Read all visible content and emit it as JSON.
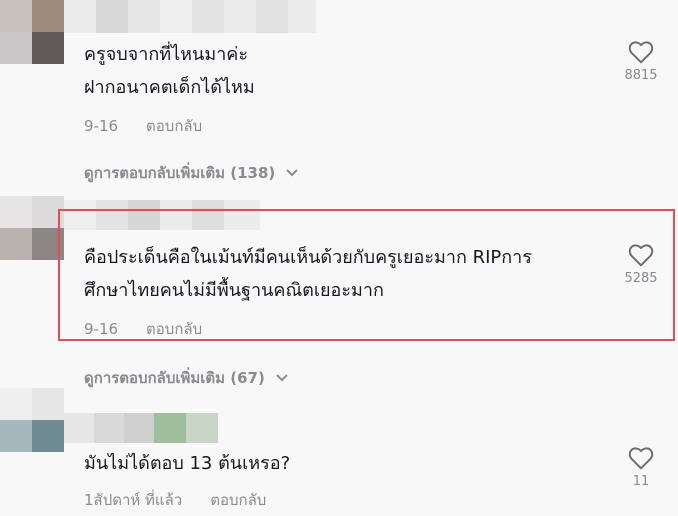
{
  "comments": [
    {
      "text_lines": [
        "ครูจบจากที่ไหนมาค่ะ",
        "ฝากอนาคตเด็กได้ไหม"
      ],
      "date": "9-16",
      "reply_label": "ตอบกลับ",
      "likes": "8815",
      "icons": {
        "like": "heart-outline-icon"
      }
    },
    {
      "text_lines": [
        "คือประเด็นคือในเม้นท์มีคนเห็นด้วยกับครูเยอะมาก RIPการ",
        "ศึกษาไทยคนไม่มีพื้นฐานคณิตเยอะมาก"
      ],
      "date": "9-16",
      "reply_label": "ตอบกลับ",
      "likes": "5285",
      "highlight_color": "#e84a55",
      "icons": {
        "like": "heart-outline-icon"
      }
    },
    {
      "text_lines": [
        "มันไม่ได้ตอบ 13 ต้นเหรอ?"
      ],
      "date": "1สัปดาห์ ที่แล้ว",
      "reply_label": "ตอบกลับ",
      "likes": "11",
      "icons": {
        "like": "heart-outline-icon"
      }
    }
  ],
  "view_more": [
    {
      "label": "ดูการตอบกลับเพิ่มเติม (138)",
      "icon": "chevron-down-icon"
    },
    {
      "label": "ดูการตอบกลับเพิ่มเติม (67)",
      "icon": "chevron-down-icon"
    }
  ],
  "colors": {
    "text": "#161823",
    "muted": "#8a8b91",
    "highlight": "#e84a55",
    "background": "#f8f8f8"
  }
}
